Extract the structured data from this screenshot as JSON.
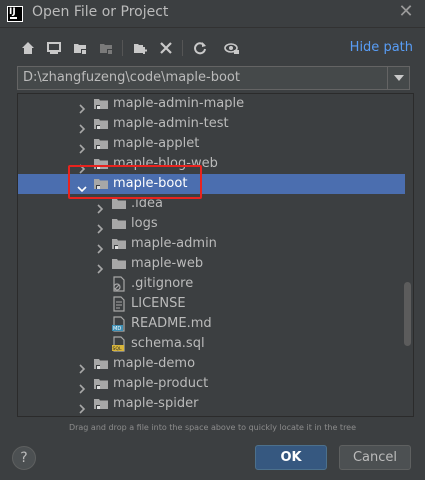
{
  "window": {
    "title": "Open File or Project",
    "app_icon": "intellij-icon"
  },
  "toolbar": {
    "icons": [
      "home-icon",
      "desktop-icon",
      "project-folder-icon",
      "module-folder-icon",
      "new-folder-icon",
      "delete-icon",
      "refresh-icon",
      "show-hidden-icon"
    ],
    "hide_path_label": "Hide path"
  },
  "path": {
    "value": "D:\\zhangfuzeng\\code\\maple-boot"
  },
  "tree": {
    "rows": [
      {
        "label": "maple-admin-maple",
        "icon": "module-folder-icon",
        "expanded": false
      },
      {
        "label": "maple-admin-test",
        "icon": "module-folder-icon",
        "expanded": false
      },
      {
        "label": "maple-applet",
        "icon": "module-folder-icon",
        "expanded": false
      },
      {
        "label": "maple-blog-web",
        "icon": "module-folder-icon",
        "expanded": false
      },
      {
        "label": "maple-boot",
        "icon": "module-folder-icon",
        "expanded": true,
        "selected": true
      },
      {
        "label": ".idea",
        "icon": "folder-icon",
        "expanded": false
      },
      {
        "label": "logs",
        "icon": "folder-icon",
        "expanded": false
      },
      {
        "label": "maple-admin",
        "icon": "module-folder-icon",
        "expanded": false
      },
      {
        "label": "maple-web",
        "icon": "folder-icon",
        "expanded": false
      },
      {
        "label": ".gitignore",
        "icon": "gitignore-file-icon"
      },
      {
        "label": "LICENSE",
        "icon": "text-file-icon"
      },
      {
        "label": "README.md",
        "icon": "markdown-file-icon"
      },
      {
        "label": "schema.sql",
        "icon": "sql-file-icon"
      },
      {
        "label": "maple-demo",
        "icon": "module-folder-icon",
        "expanded": false
      },
      {
        "label": "maple-product",
        "icon": "module-folder-icon",
        "expanded": false
      },
      {
        "label": "maple-spider",
        "icon": "module-folder-icon",
        "expanded": false
      }
    ]
  },
  "hint": "Drag and drop a file into the space above to quickly locate it in the tree",
  "buttons": {
    "help": "?",
    "ok": "OK",
    "cancel": "Cancel"
  },
  "colors": {
    "selection": "#4b6eaf",
    "link": "#589df6",
    "annotation": "#e8231e"
  }
}
